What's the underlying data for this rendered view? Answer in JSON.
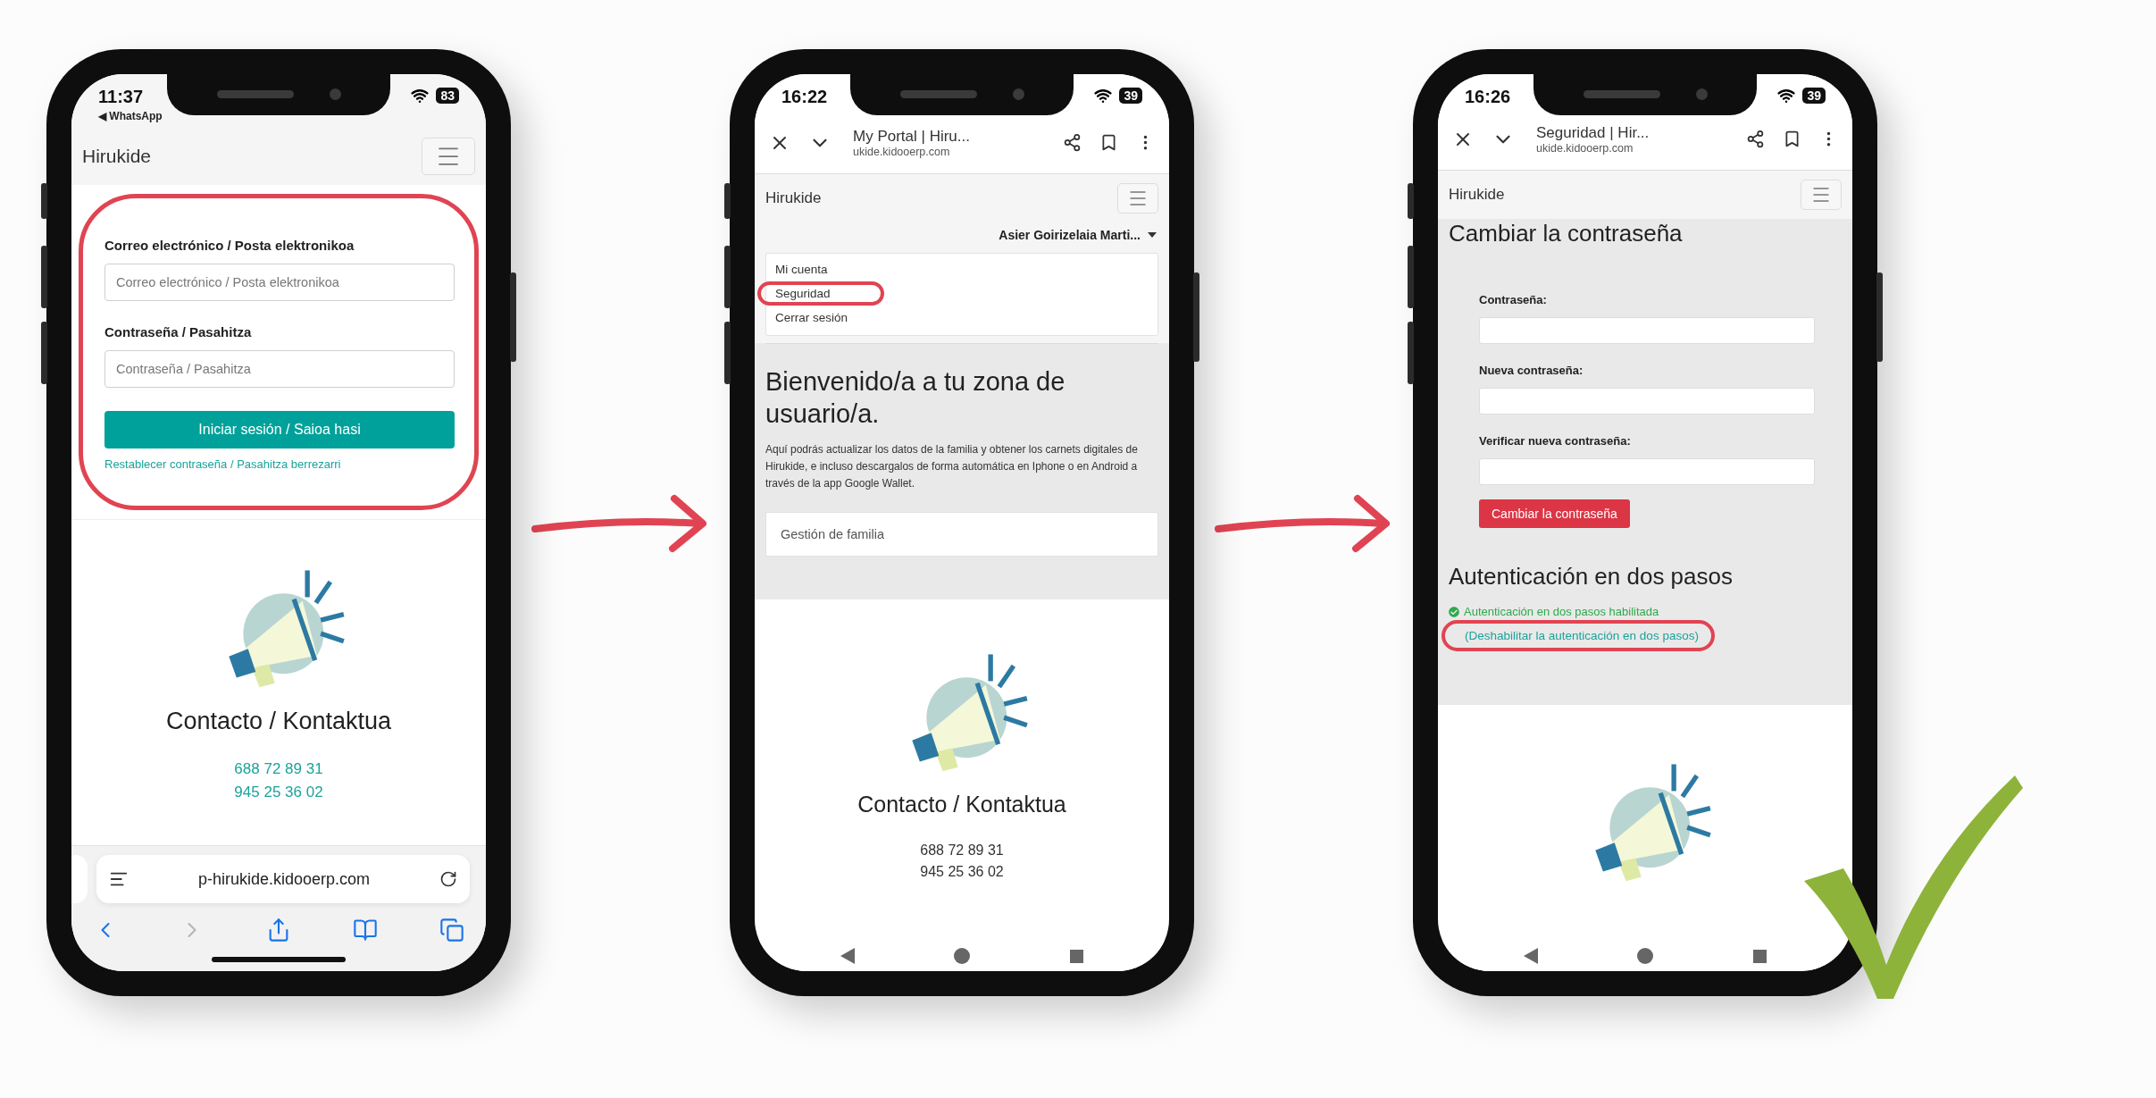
{
  "login_phone": {
    "status_bar": {
      "time": "11:37",
      "back_app": "◀ WhatsApp",
      "battery": "83"
    },
    "navbar": {
      "brand": "Hirukide"
    },
    "login_form": {
      "highlighted": true,
      "fields": [
        {
          "label": "Correo electrónico / Posta elektronikoa",
          "placeholder": "Correo electrónico / Posta elektronikoa"
        },
        {
          "label": "Contraseña / Pasahitza",
          "placeholder": "Contraseña / Pasahitza"
        }
      ],
      "submit": "Iniciar sesión / Saioa hasi",
      "reset_link": "Restablecer contraseña / Pasahitza berrezarri"
    },
    "contact": {
      "title": "Contacto / Kontaktua",
      "phones": [
        "688 72 89 31",
        "945 25 36 02"
      ]
    },
    "browser_bar": {
      "url": "p-hirukide.kidooerp.com",
      "buttons": [
        {
          "kind": "back",
          "disabled": false
        },
        {
          "kind": "forward",
          "disabled": true
        },
        {
          "kind": "share",
          "disabled": false
        },
        {
          "kind": "bookmarks",
          "disabled": false
        },
        {
          "kind": "tabs",
          "disabled": false
        }
      ]
    }
  },
  "menu_phone": {
    "status_bar": {
      "time": "16:22",
      "battery": "39"
    },
    "browser_header": {
      "title": "My Portal | Hiru...",
      "url": "ukide.kidooerp.com"
    },
    "navbar": {
      "brand": "Hirukide"
    },
    "user_menu": {
      "name": "Asier Goirizelaia Marti...",
      "items": [
        {
          "label": "Mi cuenta",
          "highlighted": false
        },
        {
          "label": "Seguridad",
          "highlighted": true
        },
        {
          "label": "Cerrar sesión",
          "highlighted": false
        }
      ]
    },
    "welcome": {
      "title": "Bienvenido/a a tu zona de usuario/a.",
      "text": "Aquí podrás actualizar los datos de la familia y obtener los carnets digitales de Hirukide, e incluso descargalos de forma automática en Iphone o en Android a través de la app Google Wallet.",
      "card": "Gestión de familia"
    },
    "contact": {
      "title": "Contacto / Kontaktua",
      "phones": [
        "688 72 89 31",
        "945 25 36 02"
      ]
    }
  },
  "security_phone": {
    "status_bar": {
      "time": "16:26",
      "battery": "39"
    },
    "browser_header": {
      "title": "Seguridad | Hir...",
      "url": "ukide.kidooerp.com"
    },
    "navbar": {
      "brand": "Hirukide"
    },
    "change_password": {
      "title": "Cambiar la contraseña",
      "fields": [
        {
          "label": "Contraseña:"
        },
        {
          "label": "Nueva contraseña:"
        },
        {
          "label": "Verificar nueva contraseña:"
        }
      ],
      "submit": "Cambiar la contraseña"
    },
    "two_factor": {
      "title": "Autenticación en dos pasos",
      "enabled": true,
      "status": "Autenticación en dos pasos habilitada",
      "link": "(Deshabilitar la autenticación en dos pasos)",
      "highlighted": true
    }
  }
}
